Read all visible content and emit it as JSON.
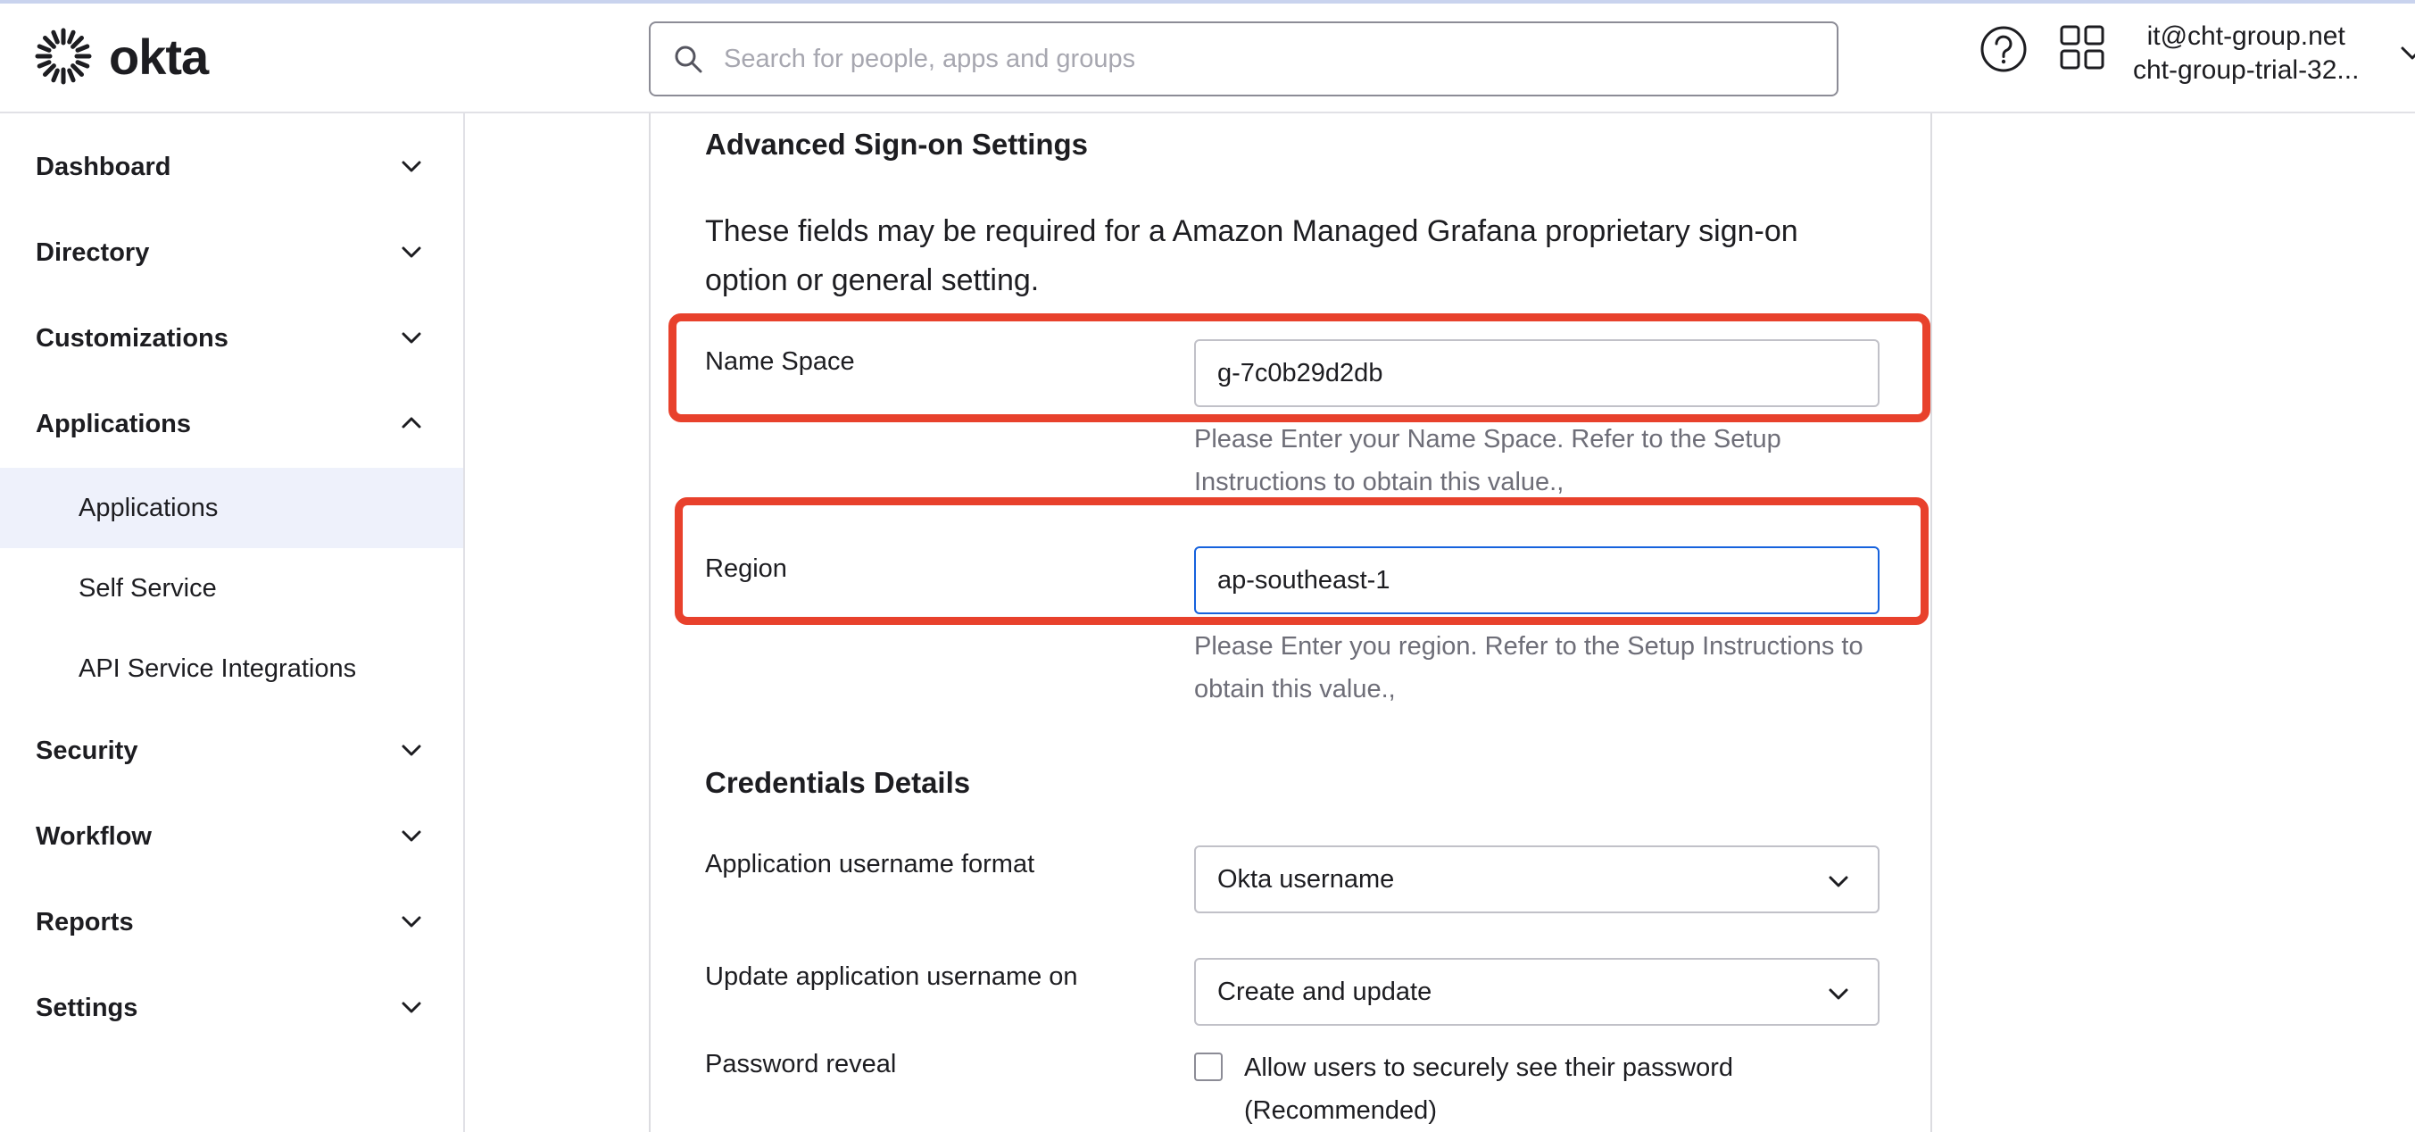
{
  "brand": {
    "name": "okta"
  },
  "search": {
    "placeholder": "Search for people, apps and groups"
  },
  "user": {
    "email": "it@cht-group.net",
    "org": "cht-group-trial-32..."
  },
  "icons": [
    "search-icon",
    "help-icon",
    "app-grid-icon",
    "chevron-down-icon",
    "chevron-up-icon"
  ],
  "colors": {
    "highlight": "#e8412c",
    "active_nav_bg": "#eef1fb",
    "focus_border": "#1662dd"
  },
  "sidebar": {
    "items": [
      {
        "label": "Dashboard"
      },
      {
        "label": "Directory"
      },
      {
        "label": "Customizations"
      },
      {
        "label": "Applications",
        "expanded": true
      },
      {
        "label": "Security"
      },
      {
        "label": "Workflow"
      },
      {
        "label": "Reports"
      },
      {
        "label": "Settings"
      }
    ],
    "subitems": [
      {
        "label": "Applications",
        "active": true
      },
      {
        "label": "Self Service"
      },
      {
        "label": "API Service Integrations"
      }
    ]
  },
  "advanced": {
    "title": "Advanced Sign-on Settings",
    "description": "These fields may be required for a Amazon Managed Grafana proprietary sign-on option or general setting.",
    "name_space": {
      "label": "Name Space",
      "value": "g-7c0b29d2db",
      "hint": "Please Enter your Name Space. Refer to the Setup Instructions to obtain this value.,"
    },
    "region": {
      "label": "Region",
      "value": "ap-southeast-1",
      "hint": "Please Enter you region. Refer to the Setup Instructions to obtain this value.,"
    }
  },
  "credentials": {
    "title": "Credentials Details",
    "username_format": {
      "label": "Application username format",
      "value": "Okta username"
    },
    "update_on": {
      "label": "Update application username on",
      "value": "Create and update"
    },
    "password_reveal": {
      "label": "Password reveal",
      "checkbox_label": "Allow users to securely see their password (Recommended)",
      "checked": false
    }
  }
}
